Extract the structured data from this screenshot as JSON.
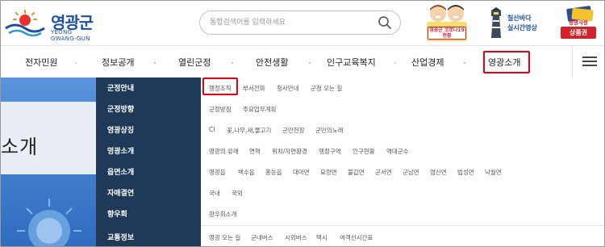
{
  "header": {
    "logo_text": "영광군",
    "logo_sub": "YEONG GWANG-GUN",
    "search_placeholder": "통합검색어를 입력하세요",
    "mascot_label": "영광군 코로나19 현황",
    "light_line1": "칠산바다",
    "light_line2": "실시간영상",
    "mall_top": "영광사랑",
    "mall_badge": "상품권"
  },
  "nav": {
    "items": [
      "전자민원",
      "정보공개",
      "열린군정",
      "안전생활",
      "인구교육복지",
      "산업경제",
      "영광소개"
    ],
    "active": "영광소개"
  },
  "hero": {
    "title": "소개"
  },
  "submenu": [
    {
      "category": "군정안내",
      "links": [
        "행정조직",
        "부서전화",
        "청사안내",
        "군청 오는 길"
      ]
    },
    {
      "category": "군정방향",
      "links": [
        "군정방침",
        "주요업무계획"
      ]
    },
    {
      "category": "영광상징",
      "links": [
        "CI",
        "꽃,나무,새,물고기",
        "군민헌장",
        "군민의노래"
      ]
    },
    {
      "category": "영광소개",
      "links": [
        "영광의 유래",
        "연혁",
        "위치/자연환경",
        "행정구역",
        "인구현황",
        "역대군수"
      ]
    },
    {
      "category": "읍면소개",
      "links": [
        "영광읍",
        "백수읍",
        "홍농읍",
        "대마면",
        "묘량면",
        "불갑면",
        "군서면",
        "군남면",
        "염산면",
        "법성면",
        "낙월면"
      ]
    },
    {
      "category": "자매결연",
      "links": [
        "국내",
        "국외"
      ]
    },
    {
      "category": "향우회",
      "links": [
        "향우회소개"
      ]
    },
    {
      "category": "교통정보",
      "links": [
        "영광 오는 길",
        "군내버스",
        "시외버스",
        "택시",
        "여객선시간표"
      ]
    }
  ]
}
